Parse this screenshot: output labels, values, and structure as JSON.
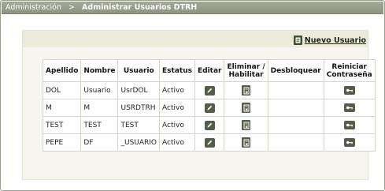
{
  "breadcrumb": {
    "parent": "Administración",
    "separator": ">",
    "current": "Administrar Usuarios DTRH"
  },
  "toolbar": {
    "new_user_label": "Nuevo Usuario",
    "new_user_icon": "document-icon"
  },
  "table": {
    "headers": {
      "apellido": "Apellido",
      "nombre": "Nombre",
      "usuario": "Usuario",
      "estatus": "Estatus",
      "editar": "Editar",
      "eliminar_l1": "Eliminar /",
      "eliminar_l2": "Habilitar",
      "desbloquear": "Desbloquear",
      "reiniciar_l1": "Reiniciar",
      "reiniciar_l2": "Contraseña"
    },
    "rows": [
      {
        "apellido": "DOL",
        "nombre": "Usuario",
        "usuario": "UsrDOL",
        "estatus": "Activo"
      },
      {
        "apellido": "M",
        "nombre": "M",
        "usuario": "USRDTRH",
        "estatus": "Activo"
      },
      {
        "apellido": "TEST",
        "nombre": "TEST",
        "usuario": "TEST",
        "estatus": "Activo"
      },
      {
        "apellido": "PEPE",
        "nombre": "DF",
        "usuario": "_USUARIO",
        "estatus": "Activo"
      }
    ],
    "row_icons": {
      "edit": "pencil-icon",
      "delete": "delete-document-icon",
      "reset": "key-icon"
    }
  },
  "colors": {
    "breadcrumb_bar": "#9a9f8b",
    "panel_background": "#f6f6ee",
    "action_icon": "#545d47"
  }
}
